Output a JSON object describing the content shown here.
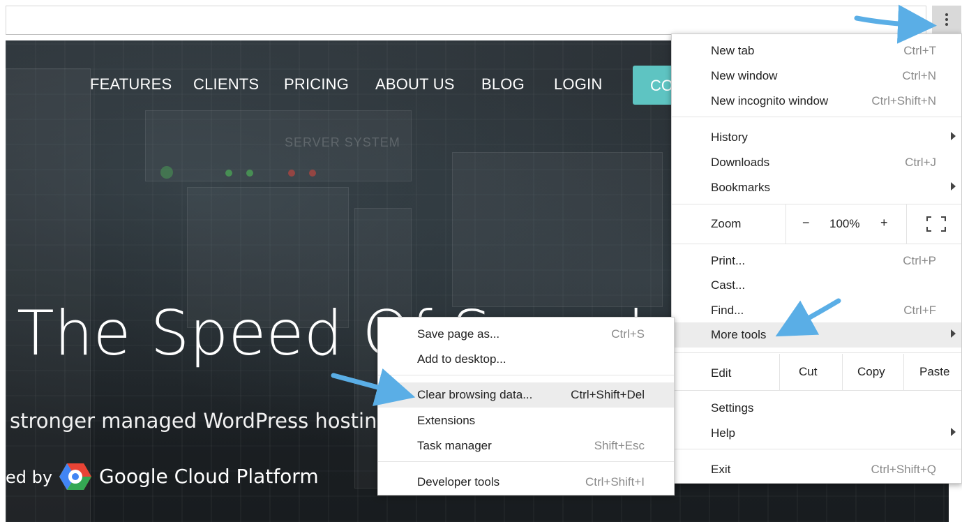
{
  "browser": {
    "menu_button_icon": "three-dots-vertical-icon",
    "star_icon": "bookmark-star-icon"
  },
  "site": {
    "nav": [
      "FEATURES",
      "CLIENTS",
      "PRICING",
      "ABOUT US",
      "BLOG",
      "LOGIN"
    ],
    "cta_label": "CO",
    "headline": "The Speed Of Speed",
    "subline": "stronger managed WordPress hosting",
    "powered_by": "ed by",
    "partner": "Google Cloud Platform"
  },
  "menu": {
    "new_tab": {
      "label": "New tab",
      "shortcut": "Ctrl+T"
    },
    "new_window": {
      "label": "New window",
      "shortcut": "Ctrl+N"
    },
    "new_incognito": {
      "label": "New incognito window",
      "shortcut": "Ctrl+Shift+N"
    },
    "history": {
      "label": "History"
    },
    "downloads": {
      "label": "Downloads",
      "shortcut": "Ctrl+J"
    },
    "bookmarks": {
      "label": "Bookmarks"
    },
    "zoom": {
      "label": "Zoom",
      "minus": "−",
      "value": "100%",
      "plus": "+"
    },
    "print": {
      "label": "Print...",
      "shortcut": "Ctrl+P"
    },
    "cast": {
      "label": "Cast..."
    },
    "find": {
      "label": "Find...",
      "shortcut": "Ctrl+F"
    },
    "more_tools": {
      "label": "More tools"
    },
    "edit": {
      "label": "Edit",
      "cut": "Cut",
      "copy": "Copy",
      "paste": "Paste"
    },
    "settings": {
      "label": "Settings"
    },
    "help": {
      "label": "Help"
    },
    "exit": {
      "label": "Exit",
      "shortcut": "Ctrl+Shift+Q"
    }
  },
  "submenu": {
    "save_page": {
      "label": "Save page as...",
      "shortcut": "Ctrl+S"
    },
    "add_desktop": {
      "label": "Add to desktop..."
    },
    "clear_data": {
      "label": "Clear browsing data...",
      "shortcut": "Ctrl+Shift+Del"
    },
    "extensions": {
      "label": "Extensions"
    },
    "task_manager": {
      "label": "Task manager",
      "shortcut": "Shift+Esc"
    },
    "dev_tools": {
      "label": "Developer tools",
      "shortcut": "Ctrl+Shift+I"
    }
  },
  "colors": {
    "accent_cta": "#5ec4c2",
    "annotation_arrow": "#5aaee6",
    "menu_highlight": "#ececec"
  }
}
